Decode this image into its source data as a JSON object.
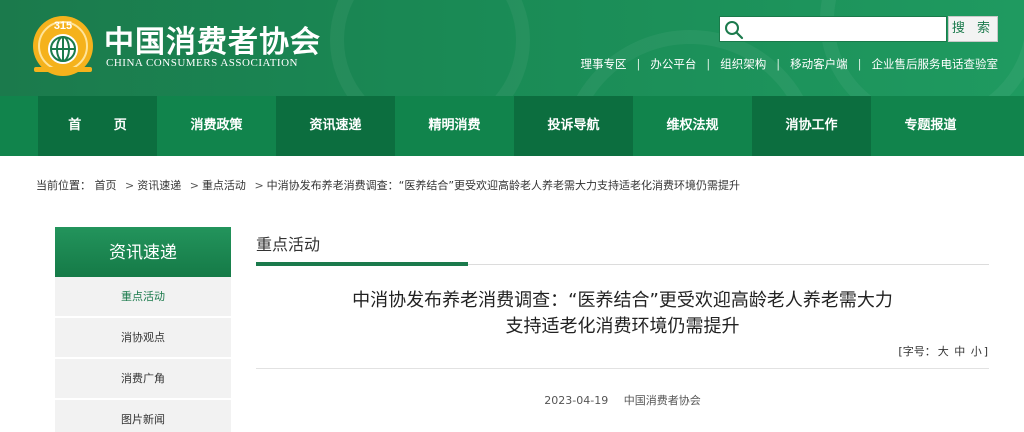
{
  "header": {
    "title": "中国消费者协会",
    "subtitle": "CHINA CONSUMERS ASSOCIATION",
    "logo_text": "315",
    "brand_color": "#1b7a4c"
  },
  "search": {
    "placeholder": "",
    "button_label": "搜 索",
    "icon": "search-icon"
  },
  "top_links": [
    "理事专区",
    "办公平台",
    "组织架构",
    "移动客户端",
    "企业售后服务电话查验室"
  ],
  "nav": [
    "首 页",
    "消费政策",
    "资讯速递",
    "精明消费",
    "投诉导航",
    "维权法规",
    "消协工作",
    "专题报道"
  ],
  "breadcrumb": {
    "prefix": "当前位置：",
    "items": [
      "首页",
      "资讯速递",
      "重点活动",
      "中消协发布养老消费调查：“医养结合”更受欢迎高龄老人养老需大力支持适老化消费环境仍需提升"
    ]
  },
  "sidebar": {
    "title": "资讯速递",
    "items": [
      "重点活动",
      "消协观点",
      "消费广角",
      "图片新闻"
    ]
  },
  "section": {
    "title": "重点活动"
  },
  "article": {
    "title_line1": "中消协发布养老消费调查：“医养结合”更受欢迎高龄老人养老需大力",
    "title_line2": "支持适老化消费环境仍需提升",
    "font_size_label": "[字号：",
    "font_sizes": [
      "大",
      "中",
      "小"
    ],
    "font_size_end": "]",
    "date": "2023-04-19",
    "source": "中国消费者协会"
  }
}
